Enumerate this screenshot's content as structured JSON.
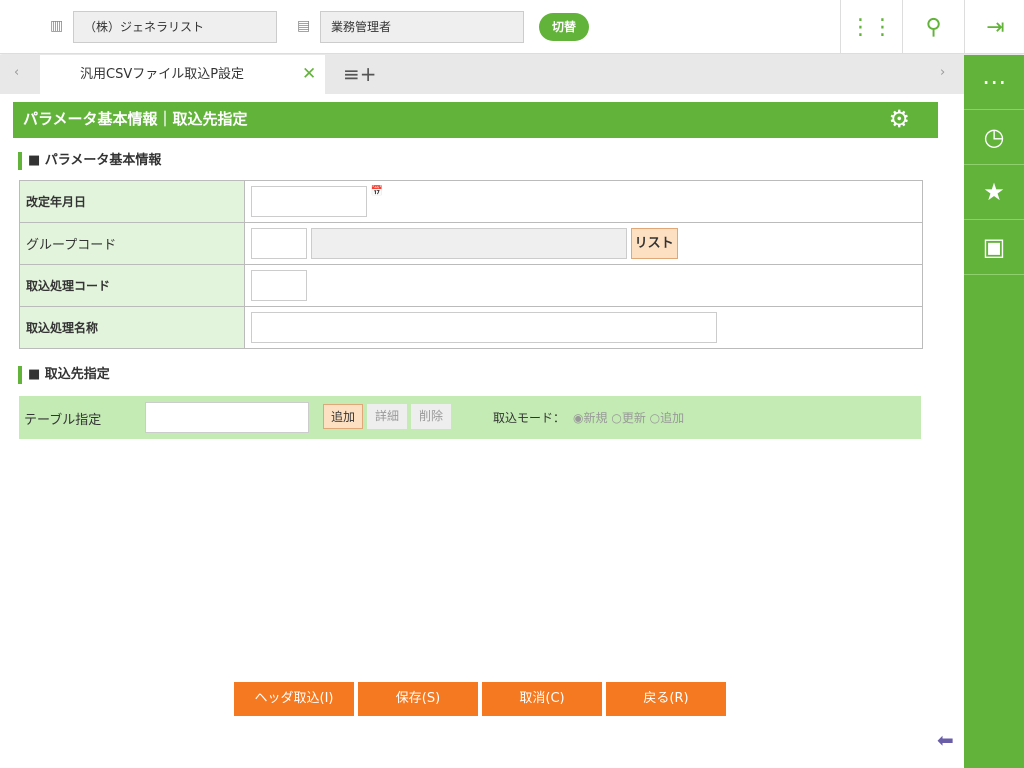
{
  "header": {
    "company": "（株）ジェネラリスト",
    "role": "業務管理者",
    "switch_label": "切替"
  },
  "tabs": [
    {
      "label": "汎用CSVファイル取込P設定"
    }
  ],
  "page": {
    "title": "パラメータ基本情報｜取込先指定"
  },
  "section1": {
    "title": "■ パラメータ基本情報",
    "rows": [
      {
        "label": "改定年月日"
      },
      {
        "label": "グループコード",
        "list_button": "リスト"
      },
      {
        "label": "取込処理コード"
      },
      {
        "label": "取込処理名称"
      }
    ]
  },
  "section2": {
    "title": "■ 取込先指定",
    "table_label": "テーブル指定",
    "add": "追加",
    "detail": "詳細",
    "delete": "削除",
    "mode_label": "取込モード：",
    "modes": [
      "新規",
      "更新",
      "追加"
    ]
  },
  "footer": {
    "header_import": "ヘッダ取込(I)",
    "save": "保存(S)",
    "cancel": "取消(C)",
    "back": "戻る(R)"
  }
}
